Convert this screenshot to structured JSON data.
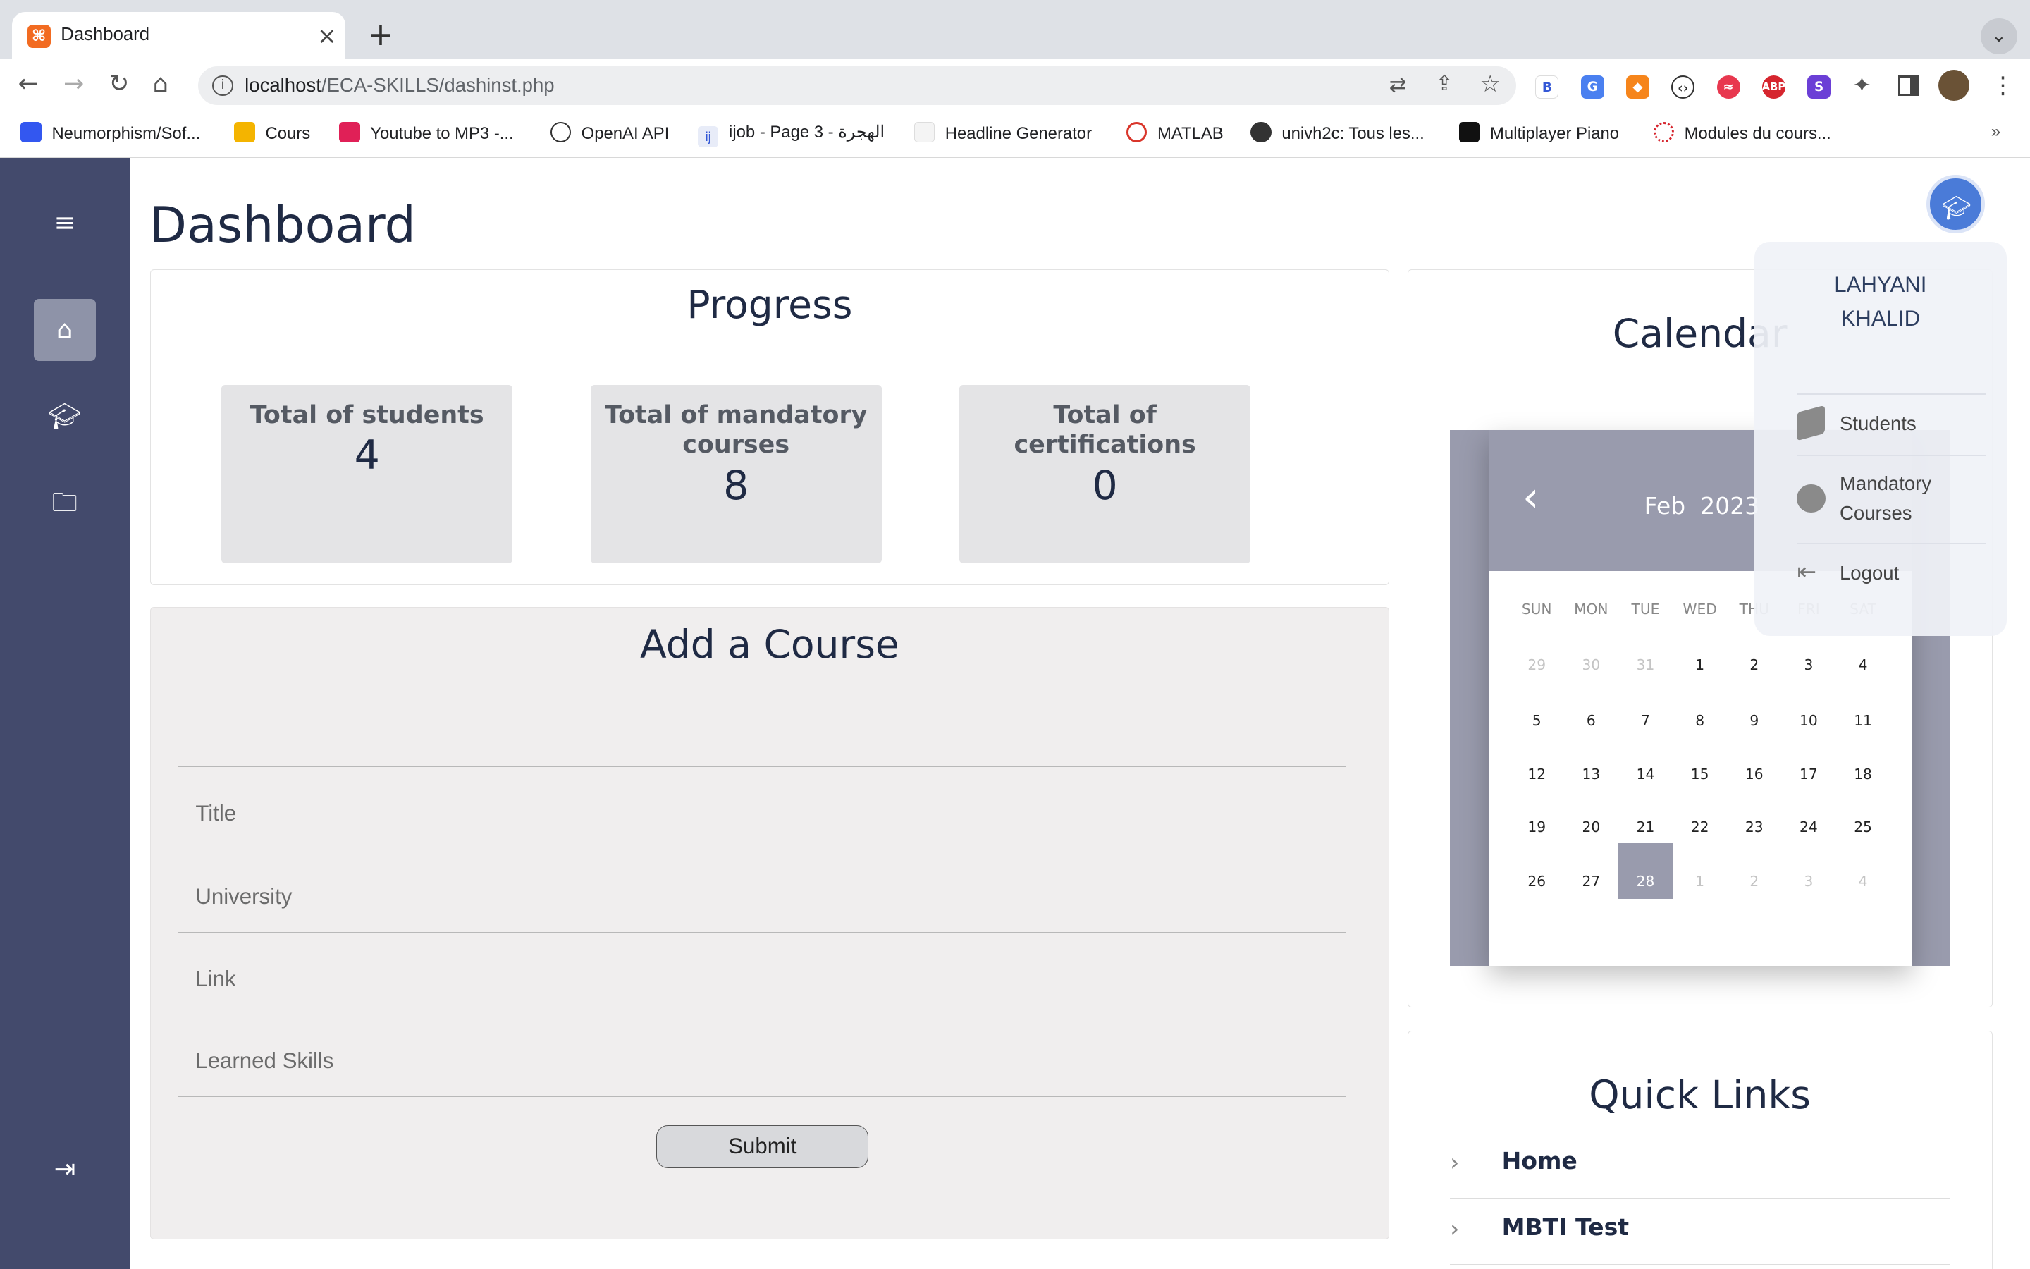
{
  "browser": {
    "tab_title": "Dashboard",
    "url_host": "localhost",
    "url_path": "/ECA-SKILLS/dashinst.php",
    "bookmarks": [
      "Neumorphism/Sof...",
      "Cours",
      "Youtube to MP3 -...",
      "OpenAI API",
      "ijob - Page 3 - الهجرة",
      "Headline Generator",
      "MATLAB",
      "univh2c: Tous les...",
      "Multiplayer Piano",
      "Modules du cours..."
    ],
    "more": "»"
  },
  "page": {
    "title": "Dashboard"
  },
  "progress": {
    "title": "Progress",
    "stats": [
      {
        "label": "Total of students",
        "value": "4"
      },
      {
        "label": "Total of mandatory courses",
        "value": "8"
      },
      {
        "label": "Total of certifications",
        "value": "0"
      }
    ]
  },
  "course_form": {
    "title": "Add a Course",
    "fields": [
      "Title",
      "University",
      "Link",
      "Learned Skills"
    ],
    "submit": "Submit"
  },
  "calendar": {
    "title": "Calendar",
    "month": "Feb",
    "year": "2023",
    "weekdays": [
      "SUN",
      "MON",
      "TUE",
      "WED",
      "THU",
      "FRI",
      "SAT"
    ],
    "weeks": [
      [
        "29",
        "30",
        "31",
        "1",
        "2",
        "3",
        "4"
      ],
      [
        "5",
        "6",
        "7",
        "8",
        "9",
        "10",
        "11"
      ],
      [
        "12",
        "13",
        "14",
        "15",
        "16",
        "17",
        "18"
      ],
      [
        "19",
        "20",
        "21",
        "22",
        "23",
        "24",
        "25"
      ],
      [
        "26",
        "27",
        "28",
        "1",
        "2",
        "3",
        "4"
      ]
    ],
    "selected_day": "28"
  },
  "quick_links": {
    "title": "Quick Links",
    "items": [
      "Home",
      "MBTI Test"
    ]
  },
  "profile": {
    "name_line1": "LAHYANI",
    "name_line2": "KHALID",
    "menu": [
      "Students",
      "Mandatory Courses",
      "Logout"
    ]
  },
  "colors": {
    "sidebar": "#434a6c",
    "calendar": "#999bad",
    "heading": "#1f2a44",
    "avatar": "#4a7bd8"
  }
}
